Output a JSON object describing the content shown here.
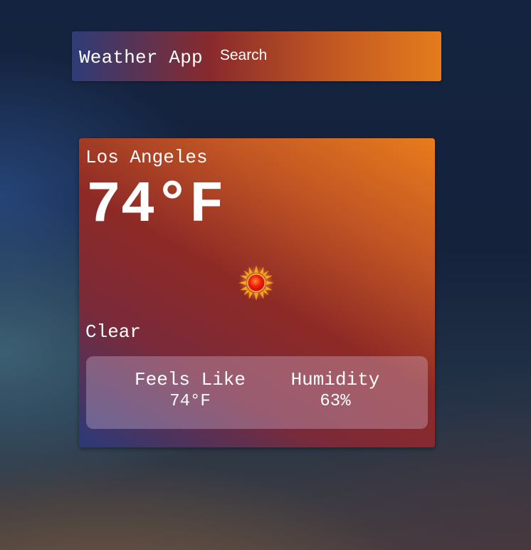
{
  "navbar": {
    "brand": "Weather App",
    "search_label": "Search"
  },
  "weather": {
    "city": "Los Angeles",
    "temperature": "74°F",
    "icon": "sun-icon",
    "condition": "Clear",
    "stats": {
      "feels_like_label": "Feels Like",
      "feels_like_value": "74°F",
      "humidity_label": "Humidity",
      "humidity_value": "63%"
    }
  },
  "colors": {
    "gradient_start": "#2a3a7a",
    "gradient_mid": "#8e2a26",
    "gradient_end": "#e87c1c",
    "text": "#ffffff"
  }
}
